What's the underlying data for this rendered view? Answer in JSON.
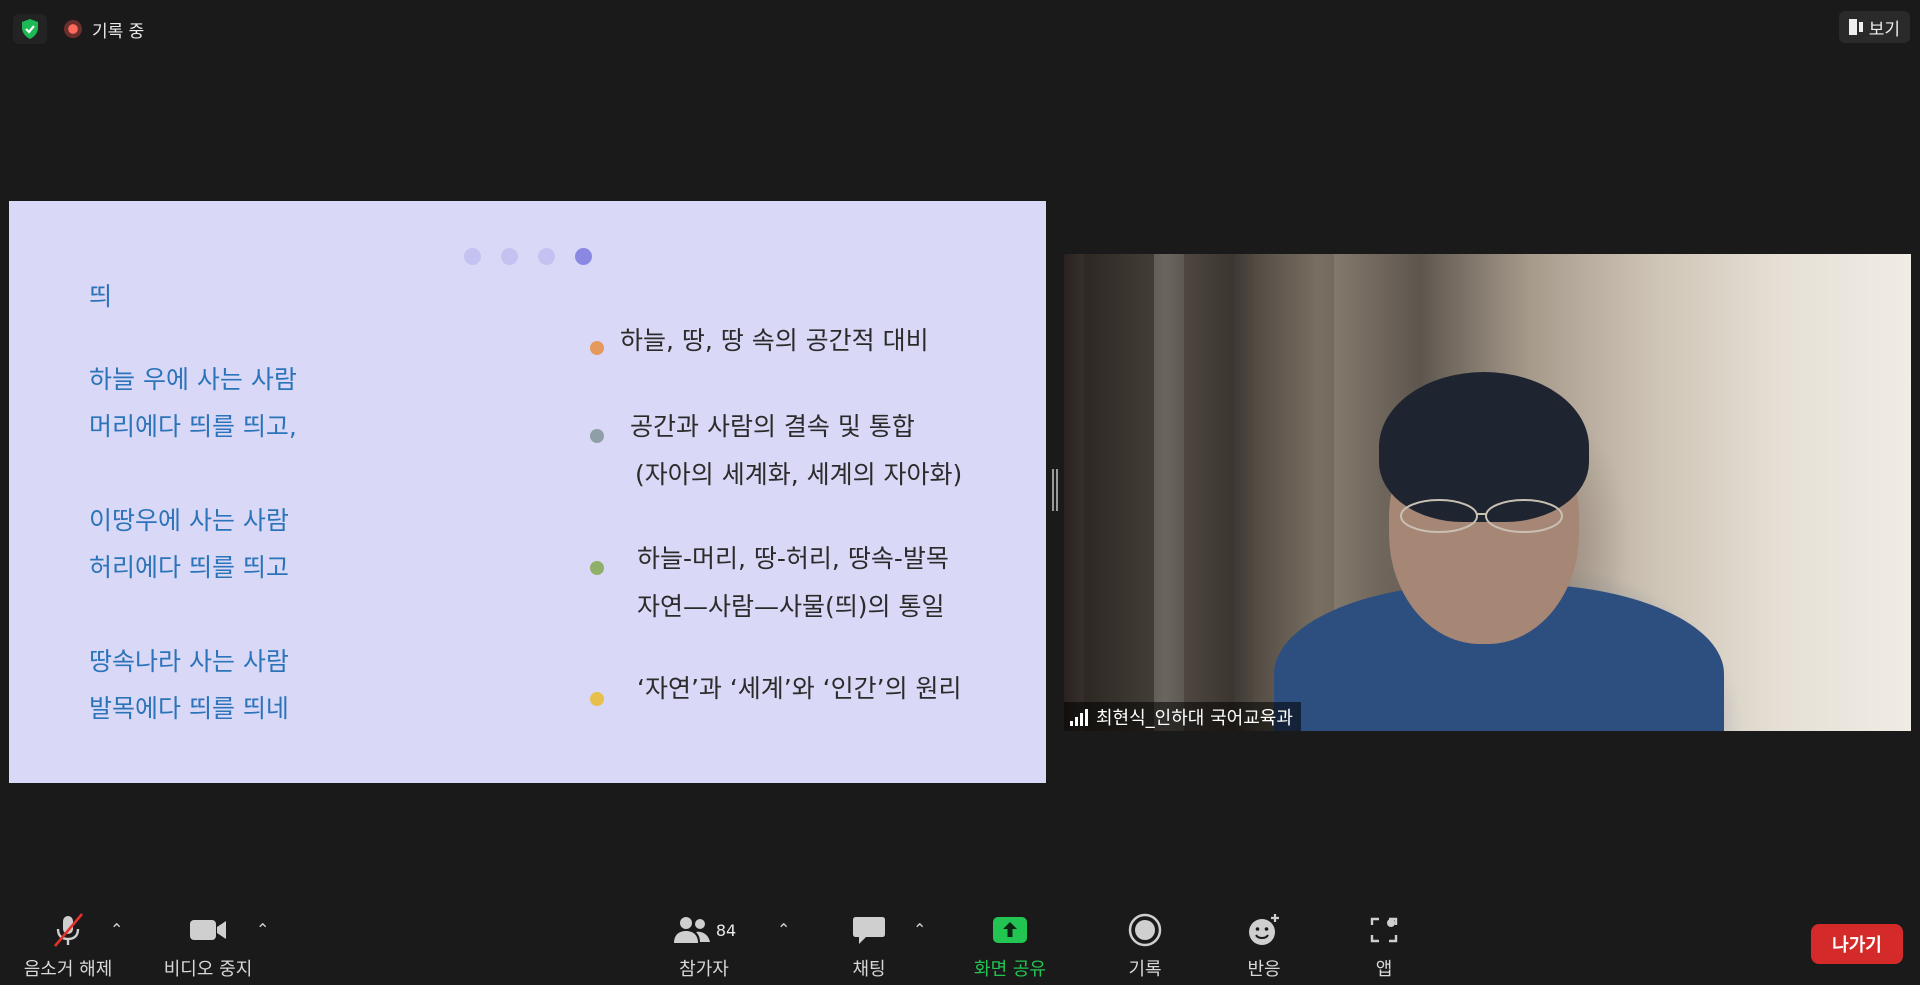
{
  "top_bar": {
    "recording_label": "기록 중",
    "view_label": "보기"
  },
  "slide": {
    "poem": {
      "title": "띄",
      "stanzas": [
        [
          "하늘 우에 사는 사람",
          "머리에다 띄를 띄고,"
        ],
        [
          "이땅우에 사는 사람",
          "허리에다 띄를 띄고"
        ],
        [
          "땅속나라 사는 사람",
          "발목에다 띄를 띄네"
        ]
      ]
    },
    "bullets": [
      {
        "color": "#e49a5c",
        "lines": [
          "하늘, 땅, 땅 속의 공간적 대비"
        ]
      },
      {
        "color": "#8f9fa8",
        "lines": [
          "공간과 사람의 결속 및 통합",
          "(자아의 세계화, 세계의 자아화)"
        ]
      },
      {
        "color": "#8fb06a",
        "lines": [
          "하늘-머리, 땅-허리, 땅속-발목",
          "자연—사람—사물(띄)의 통일"
        ]
      },
      {
        "color": "#e8bf4a",
        "lines": [
          "‘자연’과 ‘세계’와 ‘인간’의 원리"
        ]
      }
    ],
    "page_dots": 4,
    "active_dot": 4
  },
  "participant": {
    "name": "최현식_인하대 국어교육과"
  },
  "toolbar": {
    "mute_label": "음소거 해제",
    "video_label": "비디오 중지",
    "participants_label": "참가자",
    "participants_count": "84",
    "chat_label": "채팅",
    "share_label": "화면 공유",
    "record_label": "기록",
    "reaction_label": "반응",
    "apps_label": "앱",
    "leave_label": "나가기"
  },
  "colors": {
    "share_green": "#23c552",
    "leave_red": "#d42a2a",
    "slide_bg": "#d9d8f6",
    "poem_text": "#2c74b9"
  }
}
